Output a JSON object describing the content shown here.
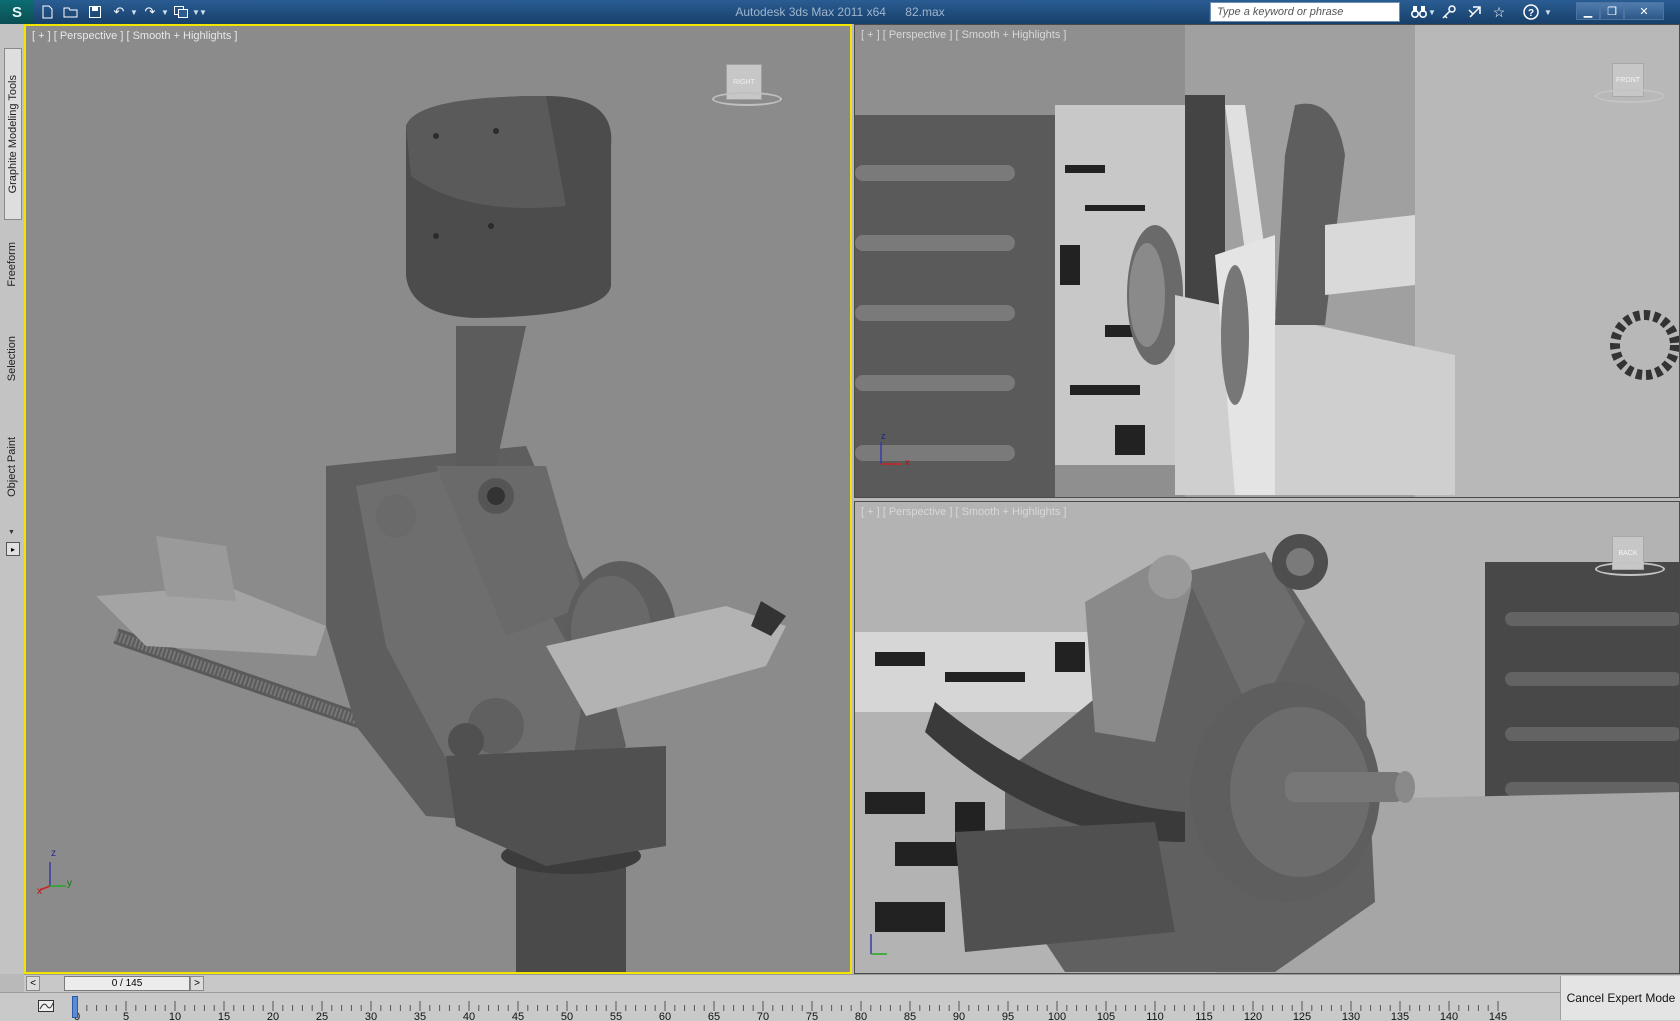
{
  "title_bar": {
    "app_name": "Autodesk 3ds Max  2011 x64",
    "file_name": "82.max",
    "search_placeholder": "Type a keyword or phrase",
    "quick_access": [
      "new-file-icon",
      "open-file-icon",
      "save-icon",
      "undo-icon",
      "redo-icon",
      "project-folder-icon"
    ],
    "help_icons": [
      "binoculars-icon",
      "key-icon",
      "comm-center-icon",
      "favorites-star-icon",
      "help-icon"
    ]
  },
  "left_tabs": [
    "Graphite Modeling Tools",
    "Freeform",
    "Selection",
    "Object Paint"
  ],
  "viewports": {
    "main": {
      "label": "[ + ] [ Perspective ] [ Smooth + Highlights ]",
      "viewcube": "RIGHT"
    },
    "top_right": {
      "label": "[ + ] [ Perspective ] [ Smooth + Highlights ]",
      "viewcube": "FRONT"
    },
    "bottom_right": {
      "label": "[ + ] [ Perspective ] [ Smooth + Highlights ]",
      "viewcube": "BACK"
    }
  },
  "axes": {
    "x": "x",
    "y": "y",
    "z": "z"
  },
  "time_slider": {
    "value": "0 / 145",
    "prev": "<",
    "next": ">"
  },
  "timeline": {
    "ticks": [
      "0",
      "5",
      "10",
      "15",
      "20",
      "25",
      "30",
      "35",
      "40",
      "45",
      "50",
      "55",
      "60",
      "65",
      "70",
      "75",
      "80",
      "85",
      "90",
      "95",
      "100",
      "105",
      "110",
      "115",
      "120",
      "125",
      "130",
      "135",
      "140",
      "145"
    ]
  },
  "status": {
    "cancel_expert": "Cancel Expert Mode"
  },
  "colors": {
    "active_border": "#f3e400",
    "titlebar": "#1f4b7c",
    "viewport_bg": "#8a8a8a"
  }
}
